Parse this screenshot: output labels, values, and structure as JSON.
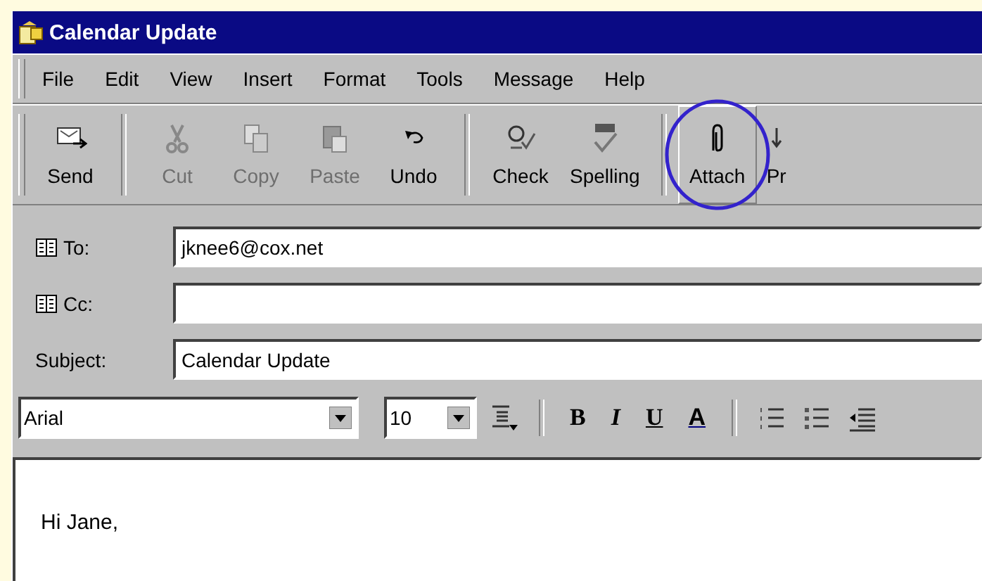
{
  "window": {
    "title": "Calendar Update"
  },
  "menu": [
    {
      "label": "File"
    },
    {
      "label": "Edit"
    },
    {
      "label": "View"
    },
    {
      "label": "Insert"
    },
    {
      "label": "Format"
    },
    {
      "label": "Tools"
    },
    {
      "label": "Message"
    },
    {
      "label": "Help"
    }
  ],
  "toolbar": [
    {
      "kind": "send",
      "label": "Send",
      "disabled": false,
      "pressed": false
    },
    {
      "kind": "separator"
    },
    {
      "kind": "cut",
      "label": "Cut",
      "disabled": true,
      "pressed": false
    },
    {
      "kind": "copy",
      "label": "Copy",
      "disabled": true,
      "pressed": false
    },
    {
      "kind": "paste",
      "label": "Paste",
      "disabled": true,
      "pressed": false
    },
    {
      "kind": "undo",
      "label": "Undo",
      "disabled": false,
      "pressed": false
    },
    {
      "kind": "separator"
    },
    {
      "kind": "check",
      "label": "Check",
      "disabled": false,
      "pressed": false
    },
    {
      "kind": "spelling",
      "label": "Spelling",
      "disabled": false,
      "pressed": false
    },
    {
      "kind": "separator"
    },
    {
      "kind": "attach",
      "label": "Attach",
      "disabled": false,
      "pressed": true
    },
    {
      "kind": "print",
      "label": "Pr",
      "disabled": false,
      "pressed": false
    }
  ],
  "fields": [
    {
      "kind": "book",
      "label": "To:",
      "value": "jknee6@cox.net"
    },
    {
      "kind": "book",
      "label": "Cc:"
    },
    {
      "kind": "plain",
      "label": "Subject:",
      "value": "Calendar Update"
    }
  ],
  "format_bar": {
    "font": "Arial",
    "size": "10",
    "buttons": [
      {
        "kind": "style"
      },
      {
        "kind": "separator"
      },
      {
        "kind": "bold",
        "label": "B"
      },
      {
        "kind": "italic",
        "label": "I"
      },
      {
        "kind": "underline",
        "label": "U"
      },
      {
        "kind": "color",
        "label": "A"
      },
      {
        "kind": "separator"
      },
      {
        "kind": "numbered"
      },
      {
        "kind": "bulleted"
      },
      {
        "kind": "outdent"
      }
    ]
  },
  "body": {
    "text": "Hi Jane,"
  }
}
